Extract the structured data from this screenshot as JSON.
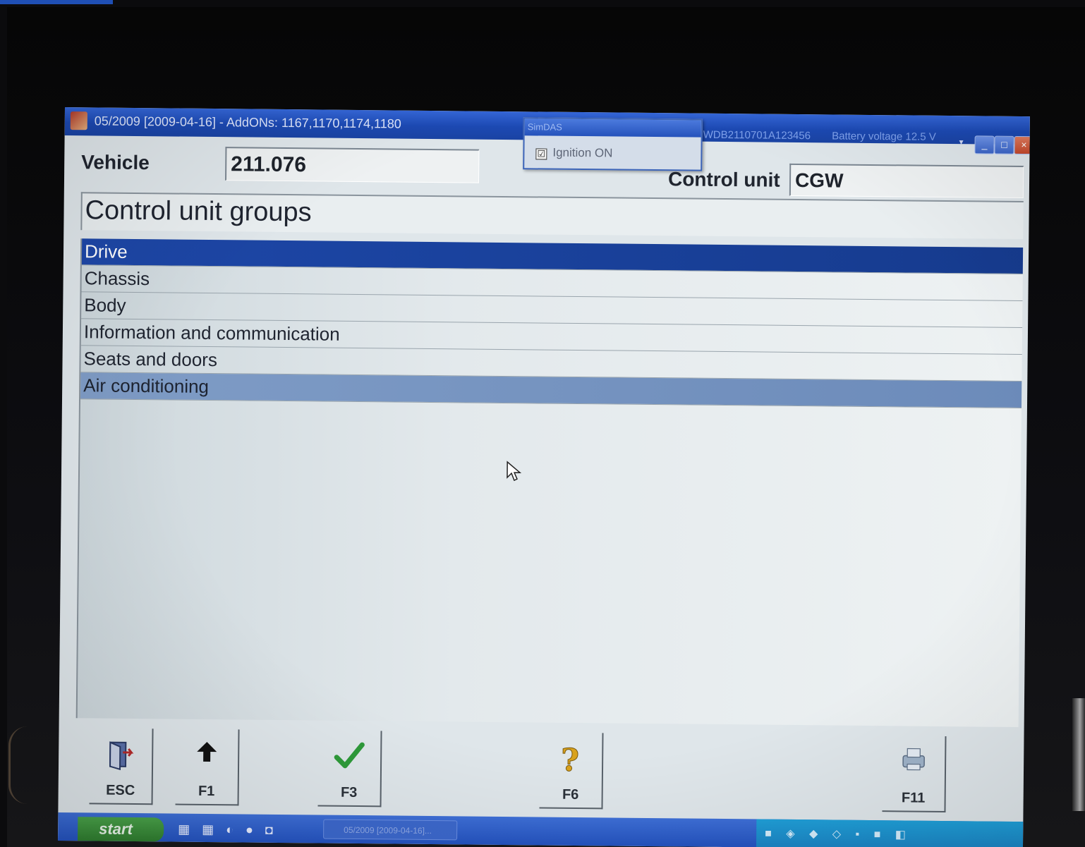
{
  "window": {
    "title": "05/2009 [2009-04-16] - AddONs: 1167,1170,1174,1180",
    "vin": "WDB2110701A123456",
    "battery": "Battery voltage 12.5 V",
    "minimize": "_",
    "maximize": "□",
    "close": "×"
  },
  "popup": {
    "title": "SimDAS",
    "checkbox_label": "Ignition ON",
    "checked": "☑"
  },
  "header": {
    "vehicle_label": "Vehicle",
    "vehicle_value": "211.076",
    "control_unit_label": "Control unit",
    "control_unit_value": "CGW"
  },
  "group_heading": "Control unit groups",
  "groups": [
    {
      "label": "Drive",
      "state": "selected"
    },
    {
      "label": "Chassis",
      "state": "normal"
    },
    {
      "label": "Body",
      "state": "normal"
    },
    {
      "label": "Information and communication",
      "state": "normal"
    },
    {
      "label": "Seats and doors",
      "state": "normal"
    },
    {
      "label": "Air conditioning",
      "state": "highlighted"
    }
  ],
  "function_keys": [
    {
      "label": "ESC",
      "icon": "exit-door-icon"
    },
    {
      "label": "F1",
      "icon": "arrow-up-icon"
    },
    {
      "label": "F3",
      "icon": "checkmark-icon"
    },
    {
      "label": "F6",
      "icon": "help-question-icon"
    },
    {
      "label": "F11",
      "icon": "printer-icon"
    }
  ],
  "taskbar": {
    "start_label": "start",
    "task_item": "05/2009 [2009-04-16]..."
  },
  "colors": {
    "titlebar": "#1c49b3",
    "selected_row": "#1d47a8",
    "highlighted_row": "#7f9cc6",
    "checkmark": "#2e9a3a",
    "help_icon": "#d9a21c"
  }
}
